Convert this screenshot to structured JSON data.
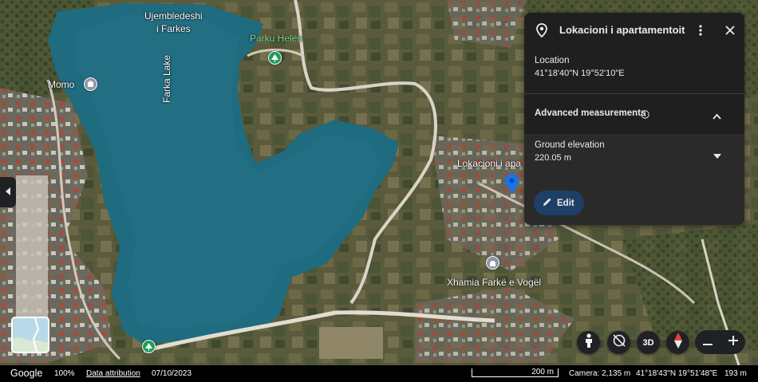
{
  "map": {
    "labels": {
      "bay_name_line1": "Ujembledeshi",
      "bay_name_line2": "i Farkes",
      "lake_name": "Farka Lake",
      "park_name": "Parku Helen",
      "momo": "Momo",
      "apartment_pin_label": "Lokacioni i apa",
      "mosque_name": "Xhamia Farkë e Vogël"
    },
    "icons": {
      "park": "park-icon",
      "momo": "restaurant-icon",
      "mosque": "mosque-icon",
      "dam_park": "park-icon",
      "pin": "location-pin-icon"
    }
  },
  "panel": {
    "title": "Lokacioni i apartamentoit",
    "location_label": "Location",
    "location_value": "41°18'40\"N 19°52'10\"E",
    "advanced_label": "Advanced measurements",
    "elevation_label": "Ground elevation",
    "elevation_value": "220.05 m",
    "edit_label": "Edit"
  },
  "controls": {
    "three_d_label": "3D"
  },
  "status_bar": {
    "logo": "Google",
    "zoom": "100%",
    "data_attribution": "Data attribution",
    "date": "07/10/2023",
    "scale_label": "200 m",
    "camera": "Camera: 2,135 m",
    "coordinates": "41°18'43\"N 19°51'48\"E",
    "altitude": "193 m"
  },
  "colors": {
    "water": "#1f6b7f",
    "panel_bg": "#1f1f1f",
    "accent_pin": "#1a73e8",
    "edit_button": "#1e3f66"
  }
}
